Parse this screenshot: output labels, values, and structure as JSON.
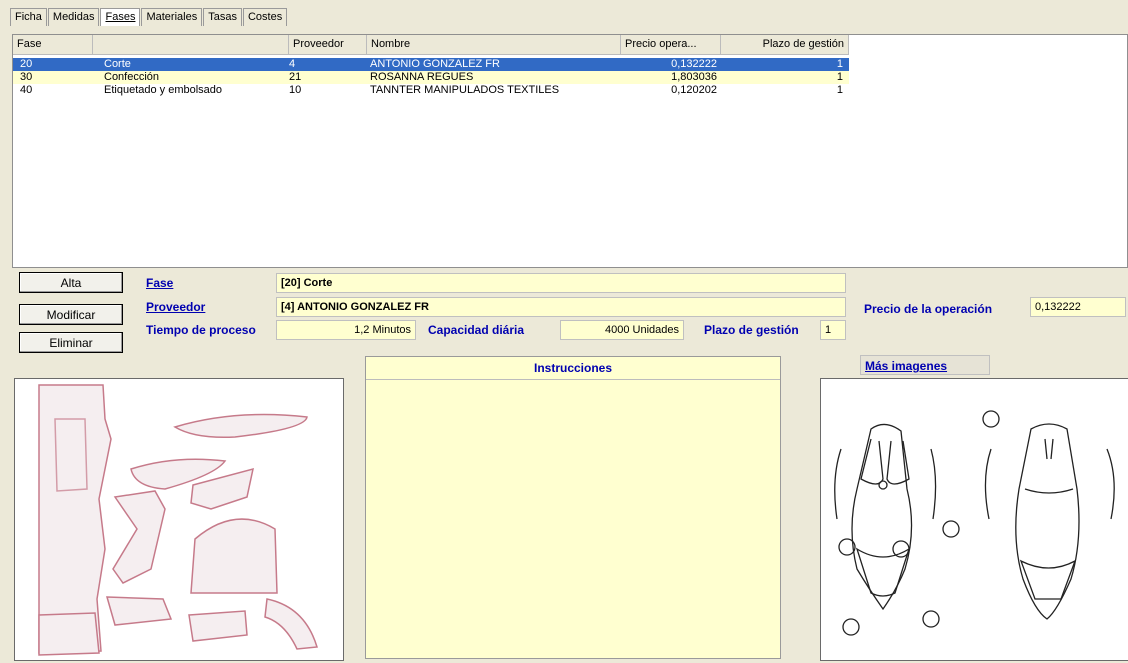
{
  "tabs": [
    {
      "label": "Ficha",
      "active": false
    },
    {
      "label": "Medidas",
      "active": false
    },
    {
      "label": "Fases",
      "active": true
    },
    {
      "label": "Materiales",
      "active": false
    },
    {
      "label": "Tasas",
      "active": false
    },
    {
      "label": "Costes",
      "active": false
    }
  ],
  "grid": {
    "headers": [
      "Fase",
      "",
      "Proveedor",
      "Nombre",
      "Precio opera...",
      "Plazo de gestión"
    ],
    "rows": [
      {
        "fase": "20",
        "desc": "Corte",
        "proveedor": "4",
        "nombre": "ANTONIO GONZALEZ FR",
        "precio": "0,132222",
        "plazo": "1",
        "state": "selected"
      },
      {
        "fase": "30",
        "desc": "Confección",
        "proveedor": "21",
        "nombre": "ROSANNA  REGUES",
        "precio": "1,803036",
        "plazo": "1",
        "state": "alt"
      },
      {
        "fase": "40",
        "desc": "Etiquetado y embolsado",
        "proveedor": "10",
        "nombre": "TANNTER MANIPULADOS TEXTILES",
        "precio": "0,120202",
        "plazo": "1",
        "state": "plain"
      }
    ]
  },
  "buttons": {
    "alta": "Alta",
    "modificar": "Modificar",
    "eliminar": "Eliminar"
  },
  "detail": {
    "fase_label": "Fase",
    "fase_value": "[20] Corte",
    "proveedor_label": "Proveedor",
    "proveedor_value": "[4] ANTONIO GONZALEZ FR",
    "tiempo_label": "Tiempo de proceso",
    "tiempo_value": "1,2 Minutos",
    "capacidad_label": "Capacidad diária",
    "capacidad_value": "4000 Unidades",
    "plazo_label": "Plazo de gestión",
    "plazo_value": "1",
    "precio_label": "Precio de la operación",
    "precio_value": "0,132222"
  },
  "instrucciones_title": "Instrucciones",
  "mas_imagenes": "Más imagenes",
  "colors": {
    "selected": "#316ac5",
    "field_bg": "#ffffd0",
    "label": "#0000b0",
    "pattern_stroke": "#c67a8a"
  }
}
